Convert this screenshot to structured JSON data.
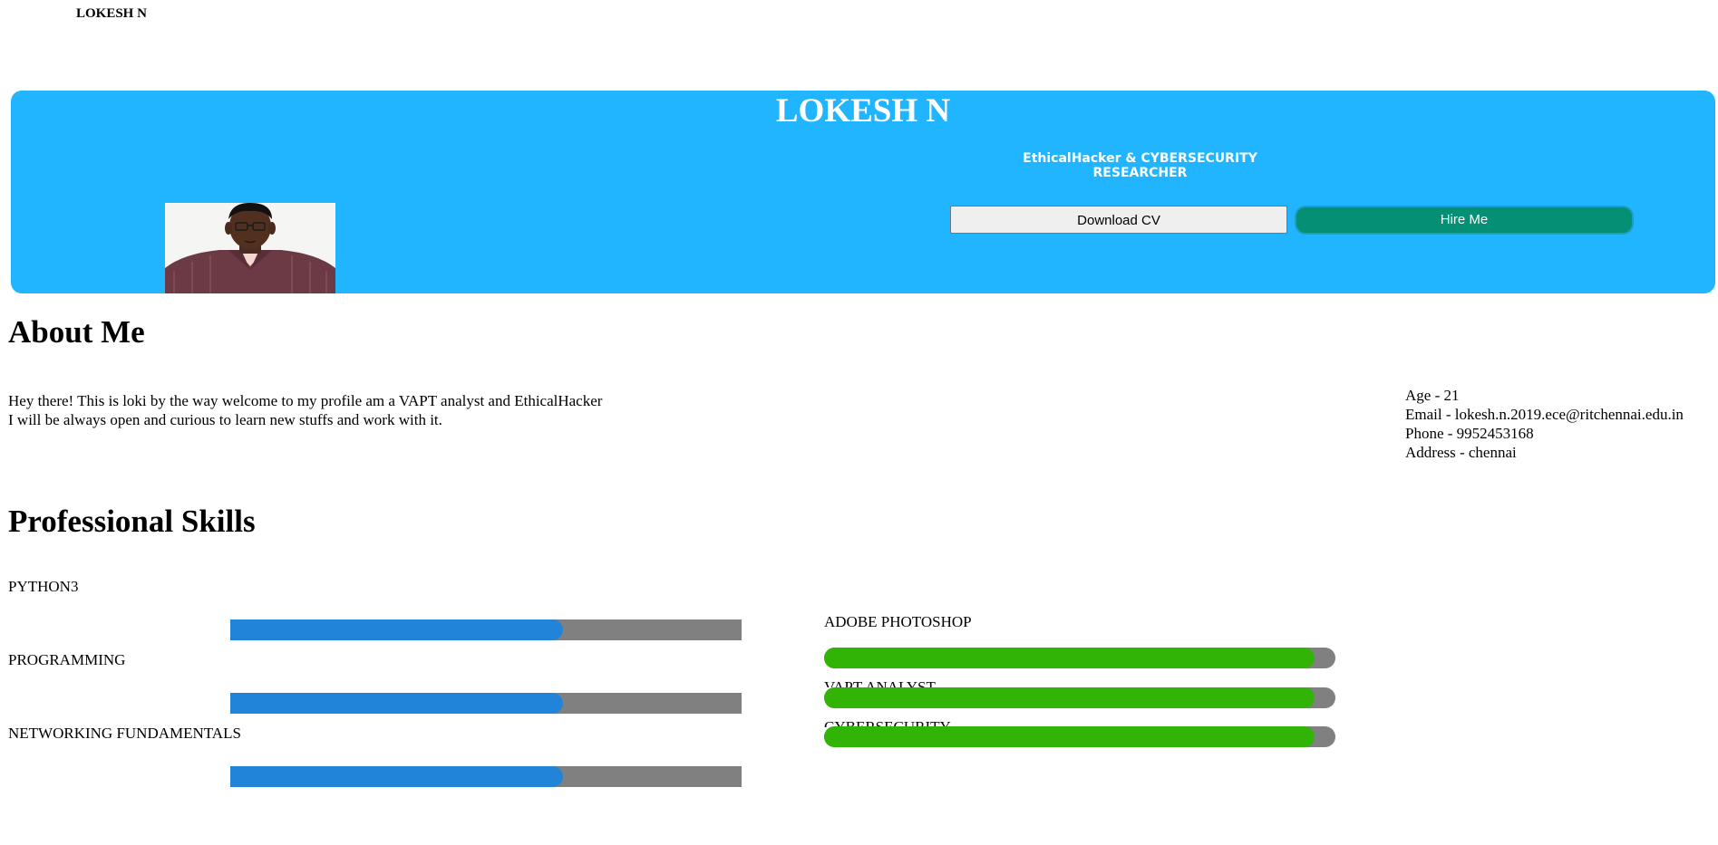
{
  "nav": {
    "logo": "LOKESH N"
  },
  "hero": {
    "title": "LOKESH N",
    "subtitle": "EthicalHacker & CYBERSECURITY RESEARCHER",
    "download_cv": "Download CV",
    "hire_me": "Hire Me",
    "bg_color": "#22b5ff"
  },
  "about": {
    "heading": "About Me",
    "line1": "Hey there! This is loki by the way welcome to my profile am a VAPT analyst and EthicalHacker",
    "line2": "I will be always open and curious to learn new stuffs and work with it.",
    "info": {
      "age": "Age -  21",
      "email": "Email -  lokesh.n.2019.ece@ritchennai.edu.in",
      "phone": "Phone -  9952453168",
      "address": "Address - chennai"
    }
  },
  "skills": {
    "heading": "Professional Skills",
    "left": [
      {
        "label": "PYTHON3",
        "level": 0.65
      },
      {
        "label": "PROGRAMMING",
        "level": 0.65
      },
      {
        "label": "NETWORKING FUNDAMENTALS",
        "level": 0.65
      }
    ],
    "right": [
      {
        "label": "ADOBE PHOTOSHOP",
        "level": 0.96
      },
      {
        "label": "VAPT ANALYST",
        "level": 0.96
      },
      {
        "label": "CYBERSECURITY",
        "level": 0.96
      }
    ],
    "left_color": "#2284d8",
    "right_color": "#32b406",
    "track_color": "#808080"
  }
}
